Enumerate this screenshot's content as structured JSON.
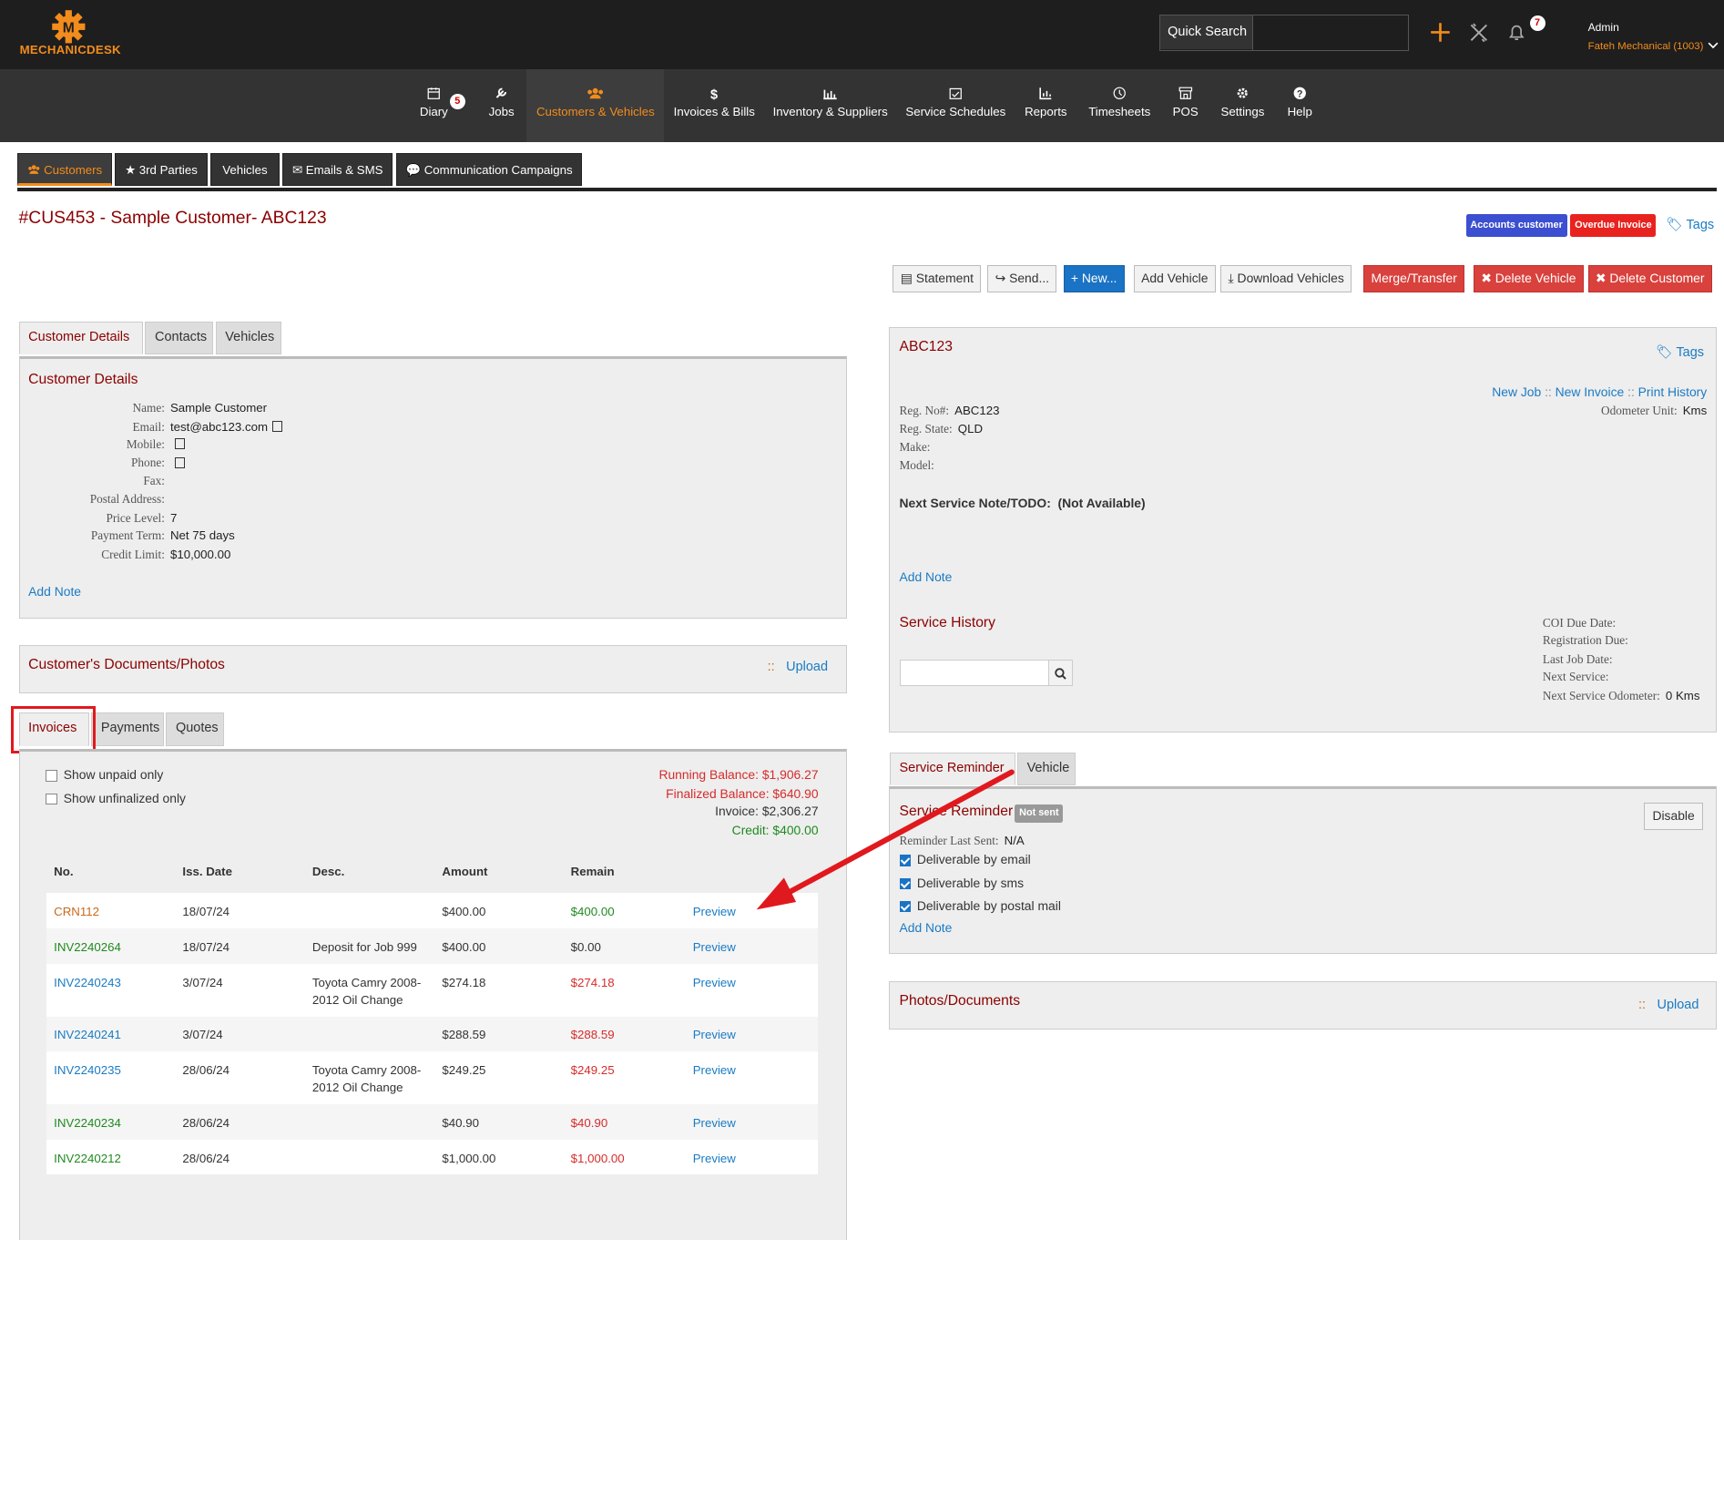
{
  "brand": {
    "name": "MechanicDesk"
  },
  "colors": {
    "brand": "#f28c1c",
    "accent": "#8b0000",
    "link": "#1a7bc4",
    "danger": "#d9413d",
    "success": "#1f8a1f",
    "primary": "#1a73c4"
  },
  "header": {
    "quick_search_label": "Quick Search",
    "notifications_count": "7",
    "user_name": "Admin",
    "workshop": "Fateh Mechanical (1003)"
  },
  "nav": [
    {
      "label": "Diary",
      "icon": "calendar-icon",
      "badge": "5"
    },
    {
      "label": "Jobs",
      "icon": "wrench-icon"
    },
    {
      "label": "Customers & Vehicles",
      "icon": "users-icon",
      "active": true
    },
    {
      "label": "Invoices & Bills",
      "icon": "dollar-icon"
    },
    {
      "label": "Inventory & Suppliers",
      "icon": "inventory-icon"
    },
    {
      "label": "Service Schedules",
      "icon": "schedule-icon"
    },
    {
      "label": "Reports",
      "icon": "chart-icon"
    },
    {
      "label": "Timesheets",
      "icon": "clock-icon"
    },
    {
      "label": "POS",
      "icon": "store-icon"
    },
    {
      "label": "Settings",
      "icon": "gear-icon"
    },
    {
      "label": "Help",
      "icon": "help-icon"
    }
  ],
  "subtabs": [
    "Customers",
    "3rd Parties",
    "Vehicles",
    "Emails & SMS",
    "Communication Campaigns"
  ],
  "page": {
    "title": "#CUS453 - Sample Customer- ABC123",
    "labels": [
      "Accounts customer",
      "Overdue Invoice"
    ],
    "tags_link": "Tags"
  },
  "actions": [
    "Statement",
    "Send...",
    "New...",
    "Add Vehicle",
    "Download Vehicles",
    "Merge/Transfer",
    "Delete Vehicle",
    "Delete Customer"
  ],
  "customer": {
    "tabs": [
      "Customer Details",
      "Contacts",
      "Vehicles"
    ],
    "heading": "Customer Details",
    "fields": [
      {
        "label": "Name:",
        "value": "Sample Customer"
      },
      {
        "label": "Email:",
        "value": "test@abc123.com"
      },
      {
        "label": "Mobile:",
        "value": ""
      },
      {
        "label": "Phone:",
        "value": ""
      },
      {
        "label": "Fax:",
        "value": ""
      },
      {
        "label": "Postal Address:",
        "value": ""
      },
      {
        "label": "Price Level:",
        "value": "7"
      },
      {
        "label": "Payment Term:",
        "value": "Net 75 days"
      },
      {
        "label": "Credit Limit:",
        "value": "$10,000.00"
      }
    ],
    "add_note": "Add Note"
  },
  "documents": {
    "heading": "Customer's Documents/Photos",
    "separator": "::",
    "upload": "Upload"
  },
  "invoices": {
    "tabs": [
      "Invoices",
      "Payments",
      "Quotes"
    ],
    "filters": [
      "Show unpaid only",
      "Show unfinalized only"
    ],
    "summary": {
      "running": "Running Balance: $1,906.27",
      "finalized": "Finalized Balance: $640.90",
      "invoice": "Invoice: $2,306.27",
      "credit": "Credit: $400.00"
    },
    "columns": [
      "No.",
      "Iss. Date",
      "Desc.",
      "Amount",
      "Remain"
    ],
    "rows": [
      {
        "no": "CRN112",
        "date": "18/07/24",
        "desc": "",
        "amount": "$400.00",
        "remain": "$400.00",
        "action": "Preview"
      },
      {
        "no": "INV2240264",
        "date": "18/07/24",
        "desc": "Deposit for Job 999",
        "amount": "$400.00",
        "remain": "$0.00",
        "action": "Preview"
      },
      {
        "no": "INV2240243",
        "date": "3/07/24",
        "desc": "Toyota Camry 2008-2012 Oil Change",
        "amount": "$274.18",
        "remain": "$274.18",
        "action": "Preview"
      },
      {
        "no": "INV2240241",
        "date": "3/07/24",
        "desc": "",
        "amount": "$288.59",
        "remain": "$288.59",
        "action": "Preview"
      },
      {
        "no": "INV2240235",
        "date": "28/06/24",
        "desc": "Toyota Camry 2008-2012 Oil Change",
        "amount": "$249.25",
        "remain": "$249.25",
        "action": "Preview"
      },
      {
        "no": "INV2240234",
        "date": "28/06/24",
        "desc": "",
        "amount": "$40.90",
        "remain": "$40.90",
        "action": "Preview"
      },
      {
        "no": "INV2240212",
        "date": "28/06/24",
        "desc": "",
        "amount": "$1,000.00",
        "remain": "$1,000.00",
        "action": "Preview"
      }
    ]
  },
  "vehicle": {
    "rego": "ABC123",
    "tags_link": "Tags",
    "links": [
      "New Job",
      "New Invoice",
      "Print History"
    ],
    "link_sep": "::",
    "odometer_label": "Odometer Unit:",
    "odometer_value": "Kms",
    "fields": [
      {
        "label": "Reg. No#:",
        "value": "ABC123"
      },
      {
        "label": "Reg. State:",
        "value": "QLD"
      },
      {
        "label": "Make:",
        "value": ""
      },
      {
        "label": "Model:",
        "value": ""
      }
    ],
    "next_service_note": "Next Service Note/TODO:",
    "next_service_value": "(Not Available)",
    "add_note": "Add Note",
    "service_history": "Service History",
    "right_fields": [
      {
        "label": "COI Due Date:",
        "value": ""
      },
      {
        "label": "Registration Due:",
        "value": ""
      },
      {
        "label": "Last Job Date:",
        "value": ""
      },
      {
        "label": "Next Service:",
        "value": ""
      },
      {
        "label": "Next Service Odometer:",
        "value": "0 Kms"
      }
    ]
  },
  "reminder": {
    "tabs": [
      "Service Reminder",
      "Vehicle"
    ],
    "heading": "Service Reminder",
    "status": "Not sent",
    "disable": "Disable",
    "last_sent_label": "Reminder Last Sent:",
    "last_sent_value": "N/A",
    "options": [
      "Deliverable by email",
      "Deliverable by sms",
      "Deliverable by postal mail"
    ],
    "add_note": "Add Note"
  },
  "photos": {
    "heading": "Photos/Documents",
    "separator": "::",
    "upload": "Upload"
  }
}
